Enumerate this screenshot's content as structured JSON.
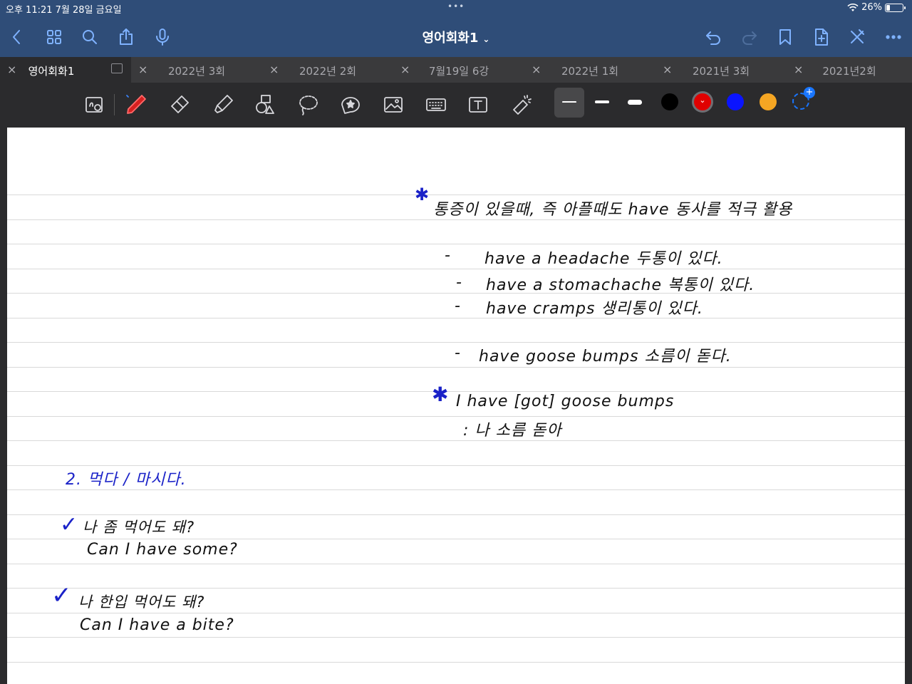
{
  "status_bar": {
    "time_date": "오후 11:21   7월 28일 금요일",
    "dots": "•••",
    "battery": "26%",
    "battery_level": 0.26
  },
  "nav": {
    "title": "영어회화1",
    "title_chevron": "⌄",
    "left_icons": [
      "back-icon",
      "grid-icon",
      "search-icon",
      "share-icon",
      "microphone-icon"
    ],
    "right_icons": [
      "undo-icon",
      "redo-icon",
      "bookmark-icon",
      "add-page-icon",
      "close-pen-icon",
      "more-icon"
    ]
  },
  "tabs": [
    {
      "label": "영어회화1",
      "active": true
    },
    {
      "label": "2022년 3회",
      "active": false
    },
    {
      "label": "2022년 2회",
      "active": false
    },
    {
      "label": "7월19일 6강",
      "active": false
    },
    {
      "label": "2022년 1회",
      "active": false
    },
    {
      "label": "2021년 3회",
      "active": false
    },
    {
      "label": "2021년2회",
      "active": false
    }
  ],
  "tab_close": "×",
  "toolbar": {
    "tools": [
      "zoom-box-icon",
      "pen-icon",
      "eraser-icon",
      "highlighter-icon",
      "shapes-icon",
      "lasso-icon",
      "sticker-icon",
      "image-icon",
      "keyboard-icon",
      "text-icon",
      "laser-pointer-icon"
    ],
    "active_tool": "pen-icon",
    "stroke_widths": [
      "thin",
      "medium",
      "thick"
    ],
    "selected_width": "thin",
    "colors": [
      "#000000",
      "#e00000",
      "#0a14ff",
      "#f5a623"
    ],
    "selected_color": "#e00000",
    "add_color": "+"
  },
  "note": {
    "right_block": {
      "heading": "통증이 있을때, 즉 아플때도 have 동사를 적극 활용",
      "items": [
        {
          "dash": "-",
          "text": "have a headache 두통이 있다."
        },
        {
          "dash": "-",
          "text": "have a stomachache 복통이 있다."
        },
        {
          "dash": "-",
          "text": "have cramps 생리통이 있다."
        },
        {
          "dash": "-",
          "text": "have goose bumps 소름이 돋다."
        }
      ],
      "example": "I have [got] goose bumps",
      "example_translation": ": 나 소름 돋아"
    },
    "left_block": {
      "section_title": "2. 먹다 / 마시다.",
      "entries": [
        {
          "korean": "나 좀 먹어도 돼?",
          "english": "Can I have some?"
        },
        {
          "korean": "나 한입 먹어도 돼?",
          "english": "Can I have a bite?"
        }
      ]
    },
    "accent_color": "#1a22c8"
  }
}
